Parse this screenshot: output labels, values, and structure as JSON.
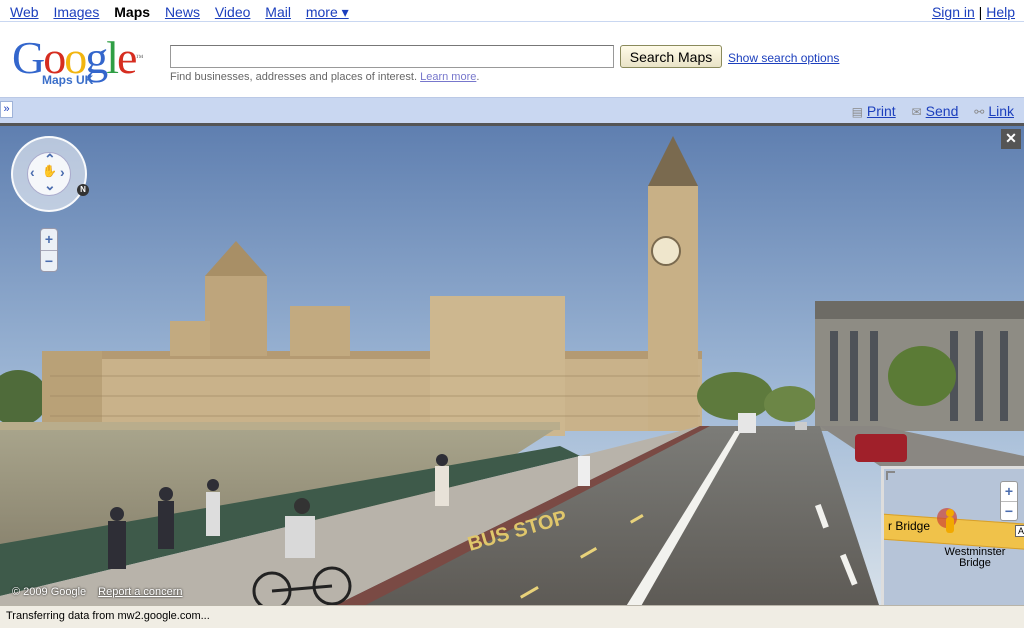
{
  "topnav": {
    "links": [
      "Web",
      "Images",
      "Maps",
      "News",
      "Video",
      "Mail",
      "more ▾"
    ],
    "current": "Maps",
    "sign_in": "Sign in",
    "separator": "|",
    "help": "Help"
  },
  "header": {
    "logo_text": "Google",
    "logo_sub": "Maps UK",
    "search_value": "",
    "search_button": "Search Maps",
    "show_options": "Show search options",
    "hint": "Find businesses, addresses and places of interest.",
    "learn_more": "Learn more"
  },
  "toolbar": {
    "expand_icon": "»",
    "print": "Print",
    "send": "Send",
    "link": "Link"
  },
  "pano": {
    "close": "✕",
    "compass_letter": "N",
    "zoom_in": "+",
    "zoom_out": "−",
    "copyright": "© 2009 Google",
    "report": "Report a concern",
    "road_markings": "BUS STOP"
  },
  "minimap": {
    "road_name": "r Bridge",
    "place": "Westminster Bridge",
    "zoom_in": "+",
    "zoom_out": "−",
    "marker": "A"
  },
  "status": {
    "text": "Transferring data from mw2.google.com..."
  }
}
